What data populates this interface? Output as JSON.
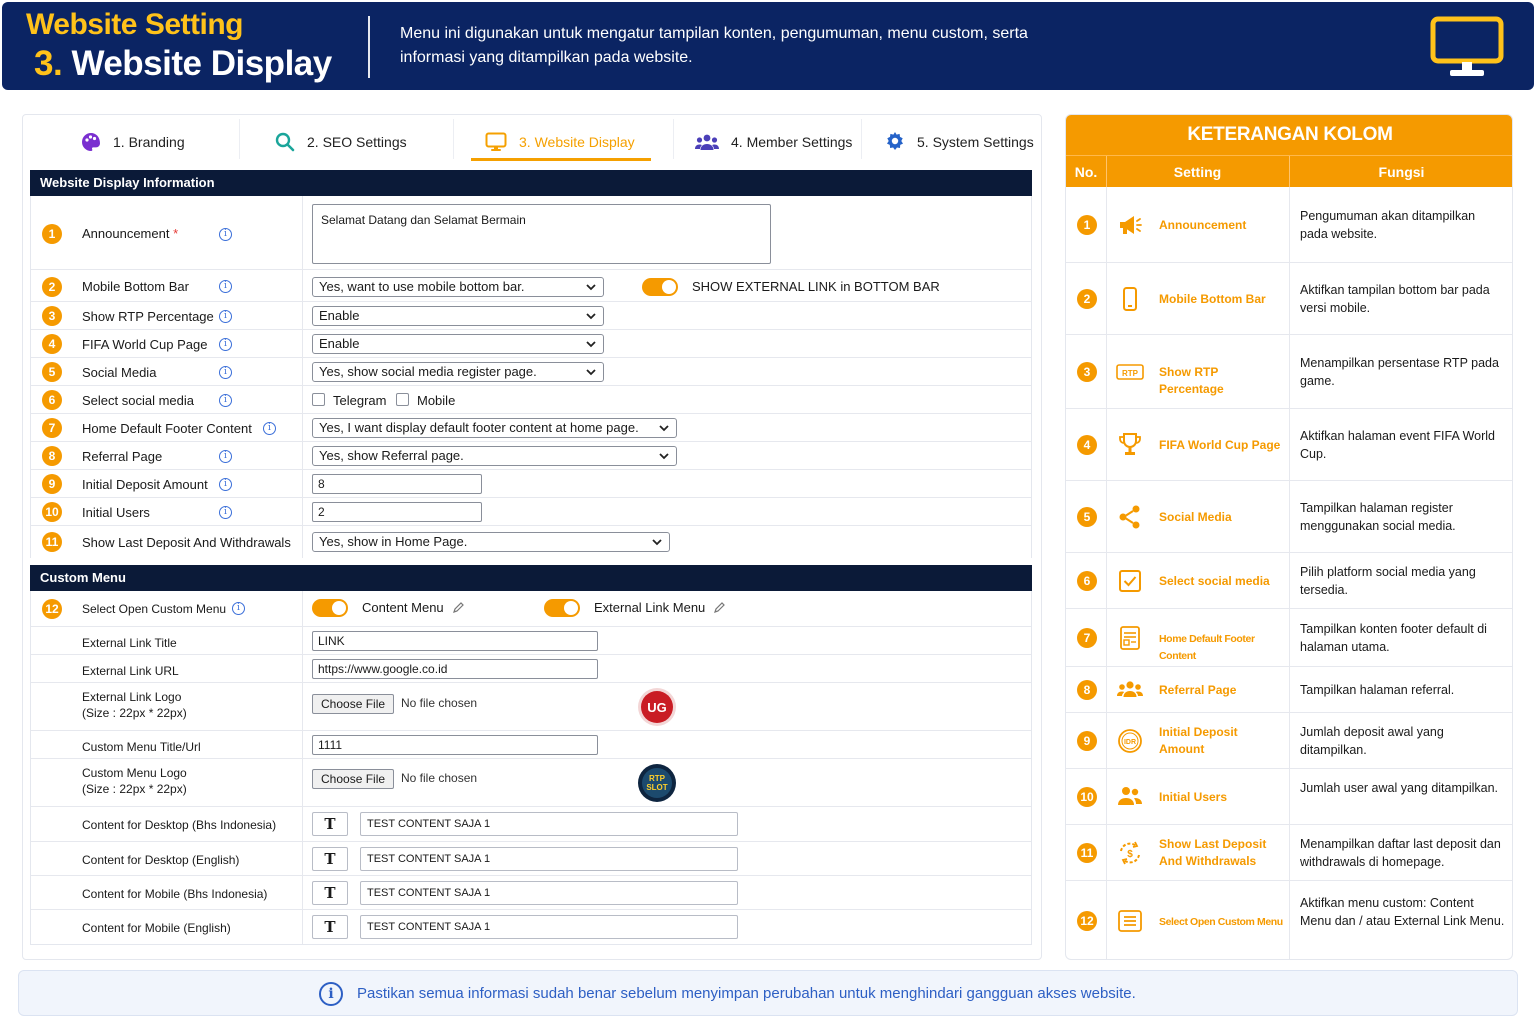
{
  "header": {
    "title_top": "Website Setting",
    "title_num": "3.",
    "title_main": "Website Display",
    "description": "Menu ini digunakan untuk mengatur tampilan konten, pengumuman, menu custom, serta informasi yang ditampilkan pada website."
  },
  "tabs": [
    {
      "label": "1. Branding",
      "icon": "palette-icon",
      "active": false
    },
    {
      "label": "2. SEO Settings",
      "icon": "search-icon",
      "active": false
    },
    {
      "label": "3. Website Display",
      "icon": "monitor-icon",
      "active": true
    },
    {
      "label": "4. Member Settings",
      "icon": "users-icon",
      "active": false
    },
    {
      "label": "5. System Settings",
      "icon": "gear-icon",
      "active": false
    }
  ],
  "display_section": {
    "title": "Website Display Information",
    "announcement": {
      "num": "1",
      "label": "Announcement",
      "required_mark": "*",
      "value": "Selamat Datang dan Selamat Bermain"
    },
    "mobile_bottom_bar": {
      "num": "2",
      "label": "Mobile Bottom Bar",
      "value": "Yes, want to use mobile bottom bar.",
      "toggle_label": "SHOW EXTERNAL LINK in BOTTOM BAR"
    },
    "show_rtp": {
      "num": "3",
      "label": "Show RTP Percentage",
      "value": "Enable"
    },
    "fifa": {
      "num": "4",
      "label": "FIFA World Cup Page",
      "value": "Enable"
    },
    "social_media": {
      "num": "5",
      "label": "Social Media",
      "value": "Yes, show social media register page."
    },
    "select_social": {
      "num": "6",
      "label": "Select social media",
      "opt1": "Telegram",
      "opt2": "Mobile"
    },
    "footer_content": {
      "num": "7",
      "label": "Home Default Footer Content",
      "value": "Yes, I want display default footer content at home page."
    },
    "referral": {
      "num": "8",
      "label": "Referral Page",
      "value": "Yes, show Referral page."
    },
    "initial_deposit": {
      "num": "9",
      "label": "Initial Deposit Amount",
      "value": "8"
    },
    "initial_users": {
      "num": "10",
      "label": "Initial Users",
      "value": "2"
    },
    "last_deposit": {
      "num": "11",
      "label": "Show Last Deposit And Withdrawals",
      "value": "Yes, show in Home Page."
    }
  },
  "custom_section": {
    "title": "Custom Menu",
    "select_open": {
      "num": "12",
      "label": "Select Open Custom Menu",
      "toggle1": "Content Menu",
      "toggle2": "External Link Menu"
    },
    "ext_title": {
      "label": "External Link Title",
      "value": "LINK"
    },
    "ext_url": {
      "label": "External Link URL",
      "value": "https://www.google.co.id"
    },
    "ext_logo": {
      "label1": "External Link Logo",
      "label2": "(Size : 22px * 22px)",
      "button": "Choose File",
      "status": "No file chosen",
      "logo_text": "UG"
    },
    "menu_title": {
      "label": "Custom Menu Title/Url",
      "value": "1111"
    },
    "menu_logo": {
      "label1": "Custom Menu Logo",
      "label2": "(Size : 22px * 22px)",
      "button": "Choose File",
      "status": "No file chosen",
      "logo_text1": "RTP",
      "logo_text2": "SLOT"
    },
    "content_desktop_id": {
      "label": "Content for Desktop (Bhs Indonesia)",
      "value": "TEST CONTENT SAJA 1"
    },
    "content_desktop_en": {
      "label": "Content for Desktop (English)",
      "value": "TEST CONTENT SAJA 1"
    },
    "content_mobile_id": {
      "label": "Content for Mobile (Bhs Indonesia)",
      "value": "TEST CONTENT SAJA 1"
    },
    "content_mobile_en": {
      "label": "Content for Mobile (English)",
      "value": "TEST CONTENT SAJA 1"
    },
    "t_label": "T"
  },
  "keterangan": {
    "title": "KETERANGAN KOLOM",
    "col_no": "No.",
    "col_setting": "Setting",
    "col_fungsi": "Fungsi",
    "rows": [
      {
        "no": "1",
        "setting": "Announcement",
        "fungsi": "Pengumuman akan ditampilkan pada website.",
        "icon": "megaphone-icon"
      },
      {
        "no": "2",
        "setting": "Mobile Bottom Bar",
        "fungsi": "Aktifkan tampilan bottom bar pada versi mobile.",
        "icon": "smartphone-icon"
      },
      {
        "no": "3",
        "setting": "Show RTP Percentage",
        "fungsi": "Menampilkan persentase RTP pada game.",
        "icon": "rtp-badge-icon",
        "icon_text": "RTP"
      },
      {
        "no": "4",
        "setting": "FIFA World Cup Page",
        "fungsi": "Aktifkan halaman event FIFA World Cup.",
        "icon": "trophy-icon"
      },
      {
        "no": "5",
        "setting": "Social Media",
        "fungsi": "Tampilkan halaman register menggunakan social media.",
        "icon": "share-icon"
      },
      {
        "no": "6",
        "setting": "Select social media",
        "fungsi": "Pilih platform social media yang tersedia.",
        "icon": "checkbox-icon"
      },
      {
        "no": "7",
        "setting": "Home Default Footer Content",
        "fungsi": "Tampilkan konten footer default di halaman utama.",
        "icon": "document-icon"
      },
      {
        "no": "8",
        "setting": "Referral Page",
        "fungsi": "Tampilkan halaman referral.",
        "icon": "group-icon"
      },
      {
        "no": "9",
        "setting": "Initial Deposit Amount",
        "fungsi": "Jumlah deposit awal yang ditampilkan.",
        "icon": "idr-coin-icon",
        "icon_text": "IDR"
      },
      {
        "no": "10",
        "setting": "Initial Users",
        "fungsi": "Jumlah user awal yang ditampilkan.",
        "icon": "users-icon"
      },
      {
        "no": "11",
        "setting": "Show Last Deposit And Withdrawals",
        "fungsi": "Menampilkan daftar last deposit dan withdrawals di homepage.",
        "icon": "refresh-money-icon"
      },
      {
        "no": "12",
        "setting": "Select Open Custom Menu",
        "fungsi": "Aktifkan menu custom: Content Menu dan / atau External Link Menu.",
        "icon": "list-icon"
      }
    ]
  },
  "footer_note": "Pastikan semua informasi sudah benar sebelum menyimpan perubahan untuk menghindari gangguan akses website.",
  "colors": {
    "navy": "#0b2463",
    "orange": "#f59a00",
    "yellow": "#ffc21a",
    "blue": "#2d5fc4"
  }
}
